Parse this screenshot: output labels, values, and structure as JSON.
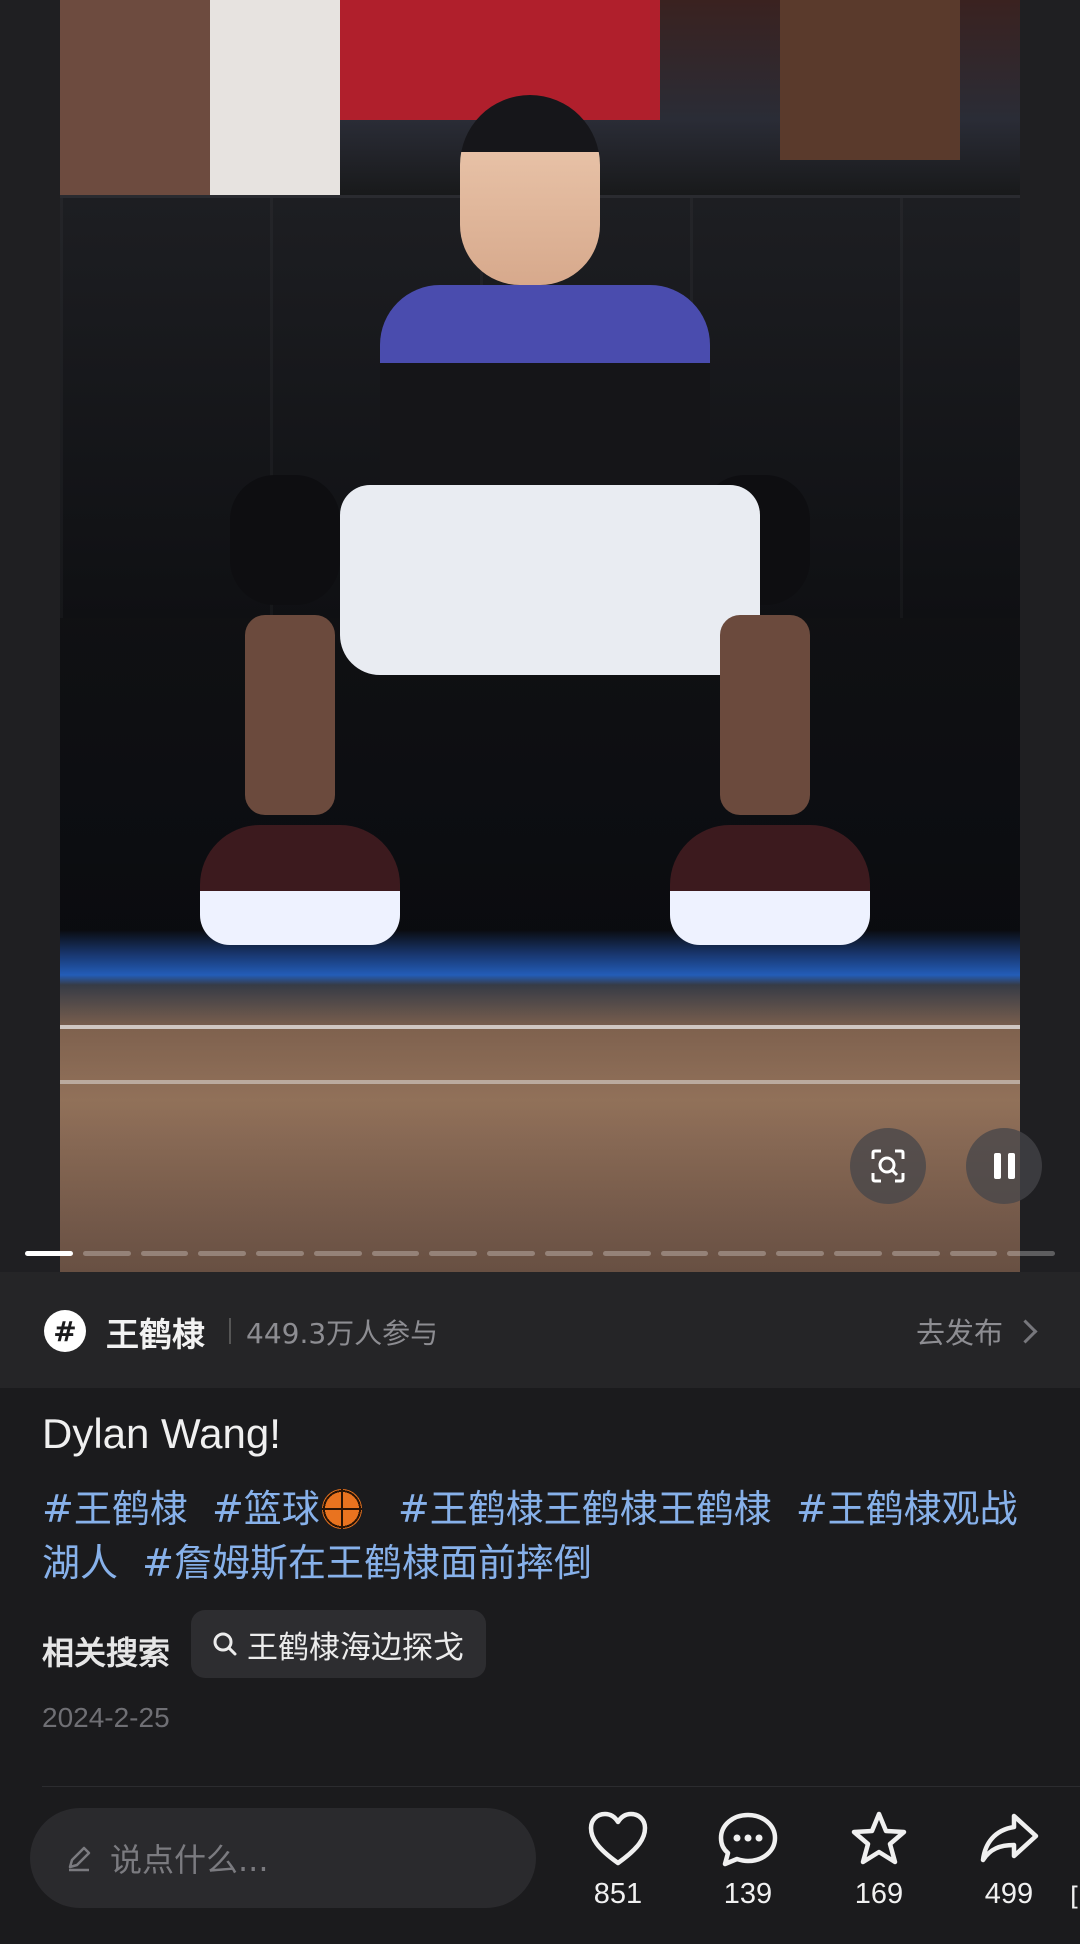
{
  "media": {
    "page_count": 18,
    "active_page": 1
  },
  "topic": {
    "badge": "#",
    "name": "王鹤棣",
    "participants": "449.3万人参与",
    "action_label": "去发布"
  },
  "post": {
    "title": "Dylan Wang!",
    "tags_line": [
      "#王鹤棣",
      "#篮球",
      "#王鹤棣王鹤棣王鹤棣",
      "#王鹤棣观战湖人",
      "#詹姆斯在王鹤棣面前摔倒"
    ],
    "related_label": "相关搜索",
    "related_query": "王鹤棣海边探戈",
    "date": "2024-2-25"
  },
  "bottom_bar": {
    "comment_placeholder": "说点什么...",
    "likes": "851",
    "comments": "139",
    "favorites": "169",
    "shares": "499",
    "edge_glyph": "["
  },
  "colors": {
    "background": "#1b1b1d",
    "topic_bar": "#252527",
    "hashtag": "#87b1ea",
    "muted_text": "#8d8d92"
  },
  "icons": [
    "scan-icon",
    "pause-icon",
    "hashtag-badge-icon",
    "chevron-right-icon",
    "basketball-emoji-icon",
    "search-icon",
    "pencil-icon",
    "heart-icon",
    "comment-bubble-icon",
    "star-icon",
    "share-arrow-icon"
  ]
}
